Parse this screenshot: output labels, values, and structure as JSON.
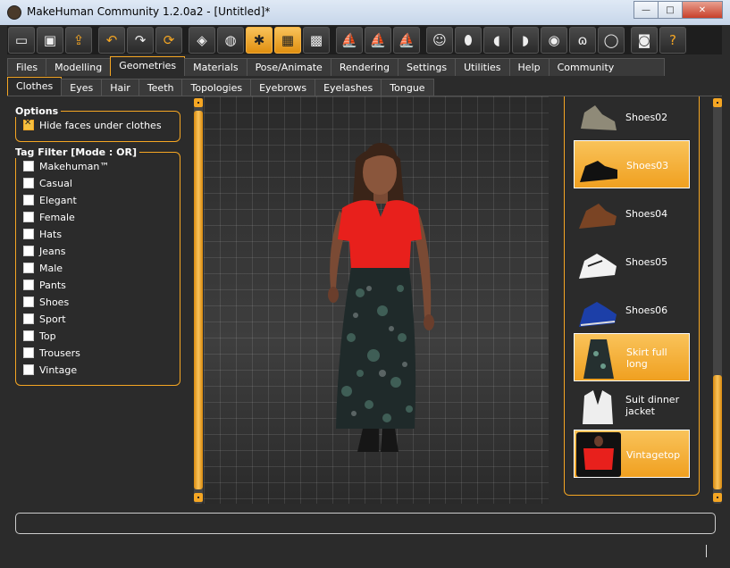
{
  "window": {
    "title": "MakeHuman Community 1.2.0a2 - [Untitled]*",
    "minimize": "—",
    "maximize": "□",
    "close": "✕"
  },
  "toolbar": {
    "icons": [
      "new-icon",
      "save-icon",
      "export-icon",
      "undo-icon",
      "redo-icon",
      "reset-icon",
      "smooth-icon",
      "wireframe-icon",
      "pose-icon",
      "grid-icon",
      "checker-icon",
      "front-view-icon",
      "side-view-icon",
      "back-view-icon",
      "face-front-icon",
      "face-back-icon",
      "face-left-icon",
      "face-right-icon",
      "top-view-icon",
      "bottom-view-icon",
      "reset-camera-icon",
      "screenshot-icon",
      "help-icon"
    ]
  },
  "main_tabs": [
    "Files",
    "Modelling",
    "Geometries",
    "Materials",
    "Pose/Animate",
    "Rendering",
    "Settings",
    "Utilities",
    "Help",
    "Community"
  ],
  "main_tab_active": "Geometries",
  "sub_tabs": [
    "Clothes",
    "Eyes",
    "Hair",
    "Teeth",
    "Topologies",
    "Eyebrows",
    "Eyelashes",
    "Tongue"
  ],
  "sub_tab_active": "Clothes",
  "options": {
    "title": "Options",
    "hide_faces": {
      "label": "Hide faces under clothes",
      "checked": true
    }
  },
  "tag_filter": {
    "title": "Tag Filter [Mode : OR]",
    "tags": [
      "Makehuman™",
      "Casual",
      "Elegant",
      "Female",
      "Hats",
      "Jeans",
      "Male",
      "Pants",
      "Shoes",
      "Sport",
      "Top",
      "Trousers",
      "Vintage"
    ]
  },
  "clothes_list": [
    {
      "label": "Shoes02",
      "selected": false,
      "icon": "shoe-icon"
    },
    {
      "label": "Shoes03",
      "selected": true,
      "icon": "shoe-icon"
    },
    {
      "label": "Shoes04",
      "selected": false,
      "icon": "shoe-icon"
    },
    {
      "label": "Shoes05",
      "selected": false,
      "icon": "shoe-icon"
    },
    {
      "label": "Shoes06",
      "selected": false,
      "icon": "shoe-icon"
    },
    {
      "label": "Skirt full long",
      "selected": true,
      "icon": "skirt-icon"
    },
    {
      "label": "Suit dinner jacket",
      "selected": false,
      "icon": "jacket-icon"
    },
    {
      "label": "Vintagetop",
      "selected": true,
      "icon": "top-icon"
    }
  ],
  "colors": {
    "accent": "#f5a623",
    "background": "#2b2b2b",
    "selected": "#f5b540"
  }
}
